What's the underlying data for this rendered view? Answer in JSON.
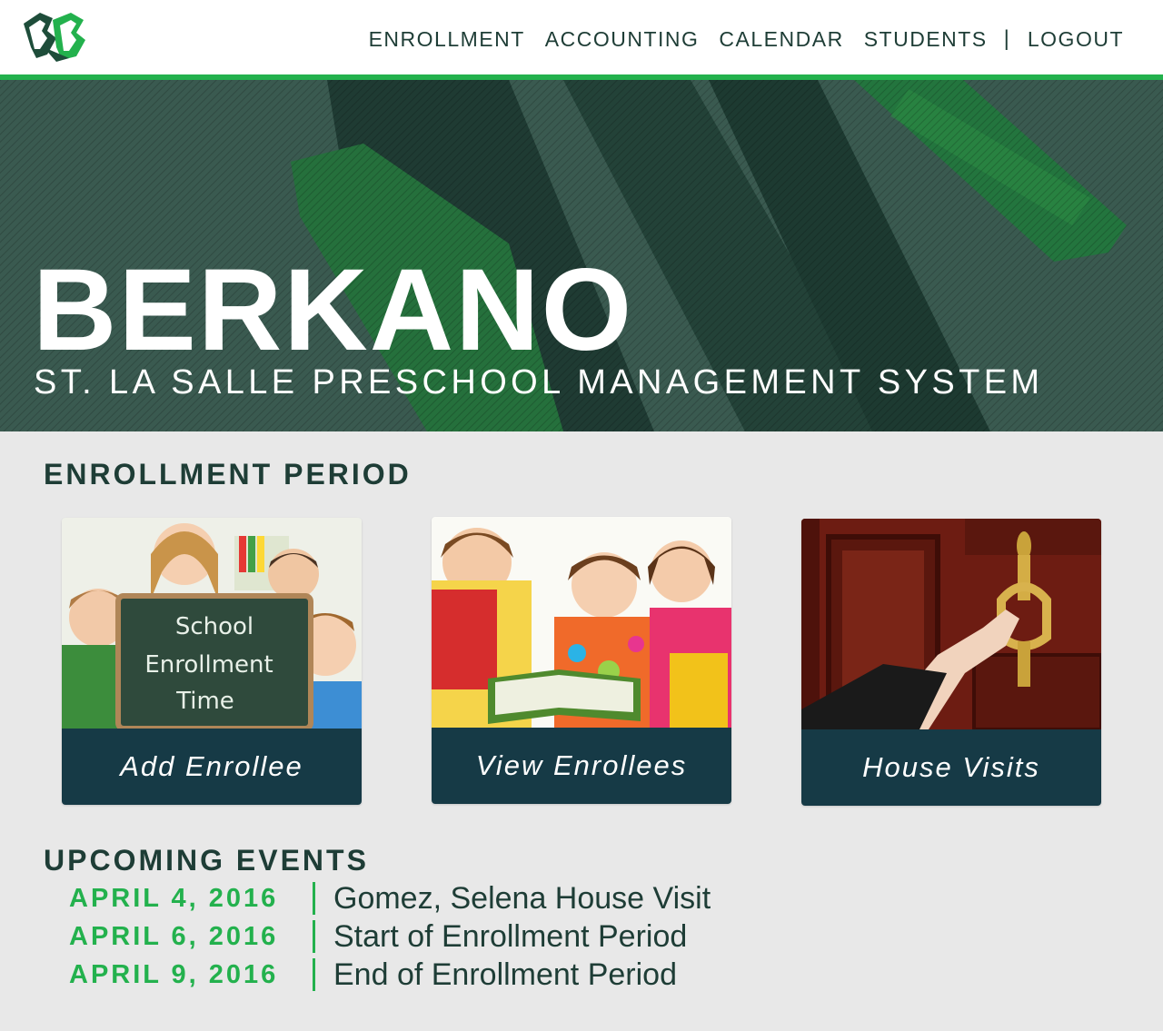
{
  "nav": {
    "items": [
      "ENROLLMENT",
      "ACCOUNTING",
      "CALENDAR",
      "STUDENTS"
    ],
    "separator": "|",
    "logout": "LOGOUT"
  },
  "hero": {
    "title": "BERKANO",
    "subtitle": "ST. LA SALLE PRESCHOOL MANAGEMENT SYSTEM"
  },
  "enrollment": {
    "heading": "ENROLLMENT PERIOD",
    "cards": [
      {
        "label": "Add Enrollee",
        "chalkboard_lines": [
          "School",
          "Enrollment",
          "Time"
        ]
      },
      {
        "label": "View Enrollees"
      },
      {
        "label": "House Visits"
      }
    ]
  },
  "events": {
    "heading": "UPCOMING EVENTS",
    "items": [
      {
        "date": "APRIL 4, 2016",
        "text": "Gomez, Selena House Visit"
      },
      {
        "date": "APRIL 6, 2016",
        "text": "Start of Enrollment Period"
      },
      {
        "date": "APRIL 9, 2016",
        "text": "End of Enrollment Period"
      }
    ]
  },
  "colors": {
    "accent": "#23b14d",
    "hero_bg": "#2c4a40",
    "card_label_bg": "#163a46",
    "text_dark": "#1e3d36",
    "page_bg": "#e8e8e8"
  }
}
